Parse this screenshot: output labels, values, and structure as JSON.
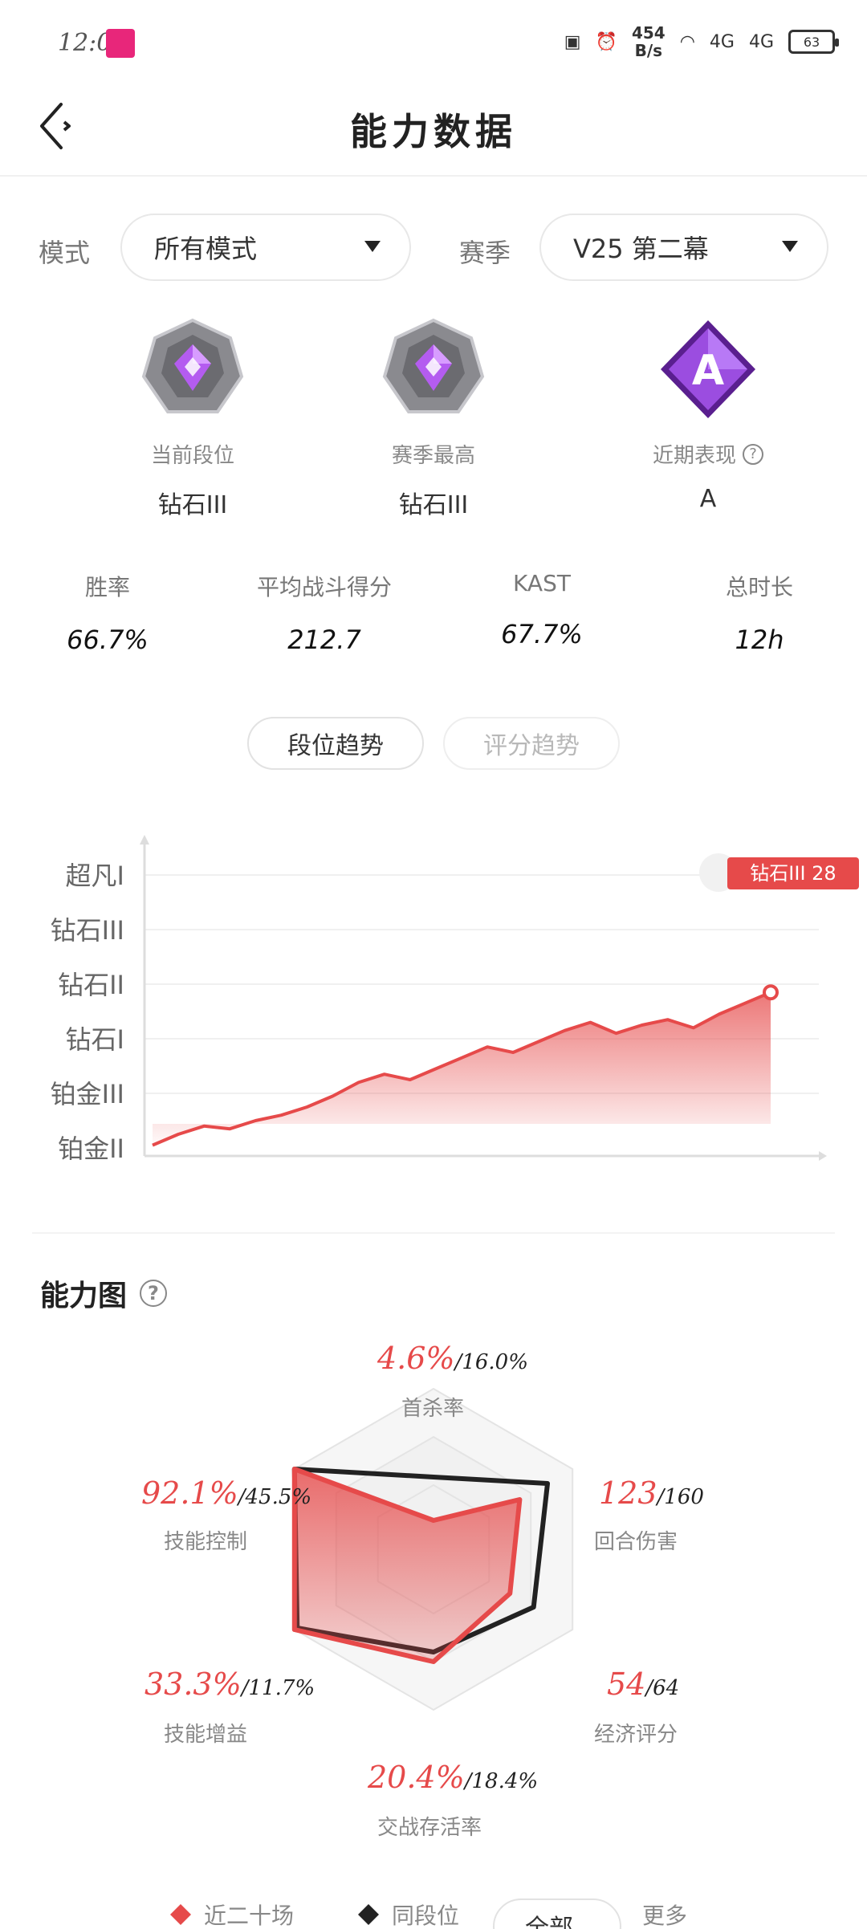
{
  "status_bar": {
    "time": "12:01",
    "speed_value": "454",
    "speed_unit": "B/s",
    "net1": "4G",
    "net2": "4G",
    "battery": "63"
  },
  "header": {
    "title": "能力数据"
  },
  "filters": {
    "mode_label": "模式",
    "mode_value": "所有模式",
    "season_label": "赛季",
    "season_value": "V25 第二幕"
  },
  "ranks": [
    {
      "label": "当前段位",
      "value": "钻石III"
    },
    {
      "label": "赛季最高",
      "value": "钻石III"
    },
    {
      "label": "近期表现",
      "value": "A",
      "badge_letter": "A"
    }
  ],
  "stats": [
    {
      "label": "胜率",
      "value": "66.7%"
    },
    {
      "label": "平均战斗得分",
      "value": "212.7"
    },
    {
      "label": "KAST",
      "value": "67.7%"
    },
    {
      "label": "总时长",
      "value": "12h"
    }
  ],
  "trend_tabs": [
    "段位趋势",
    "评分趋势"
  ],
  "chart_data": {
    "type": "area",
    "y_tick_labels": [
      "铂金II",
      "铂金III",
      "钻石I",
      "钻石II",
      "钻石III",
      "超凡I"
    ],
    "values": [
      0.05,
      0.25,
      0.4,
      0.35,
      0.5,
      0.6,
      0.75,
      0.95,
      1.2,
      1.35,
      1.25,
      1.45,
      1.65,
      1.85,
      1.75,
      1.95,
      2.15,
      2.3,
      2.1,
      2.25,
      2.35,
      2.2,
      2.45,
      2.65,
      2.85
    ],
    "ylim": [
      0,
      5
    ],
    "current_label": "钻石III 28",
    "color": "#e64a4a"
  },
  "ability": {
    "title": "能力图",
    "axes": [
      {
        "name": "首杀率",
        "mine": "4.6%",
        "avg": "16.0%",
        "mine_r": 0.18,
        "avg_r": 0.45
      },
      {
        "name": "回合伤害",
        "mine": "123",
        "avg": "160",
        "mine_r": 0.62,
        "avg_r": 0.82
      },
      {
        "name": "经济评分",
        "mine": "54",
        "avg": "64",
        "mine_r": 0.55,
        "avg_r": 0.72
      },
      {
        "name": "交战存活率",
        "mine": "20.4%",
        "avg": "18.4%",
        "mine_r": 0.7,
        "avg_r": 0.64
      },
      {
        "name": "技能增益",
        "mine": "33.3%",
        "avg": "11.7%",
        "mine_r": 1.0,
        "avg_r": 0.98
      },
      {
        "name": "技能控制",
        "mine": "92.1%",
        "avg": "45.5%",
        "mine_r": 1.0,
        "avg_r": 1.0
      }
    ],
    "colors": {
      "mine": "#e64a4a",
      "avg": "#222222"
    }
  },
  "legend": {
    "mine": "近二十场",
    "avg": "同段位",
    "select": "全部",
    "other": "更多"
  }
}
